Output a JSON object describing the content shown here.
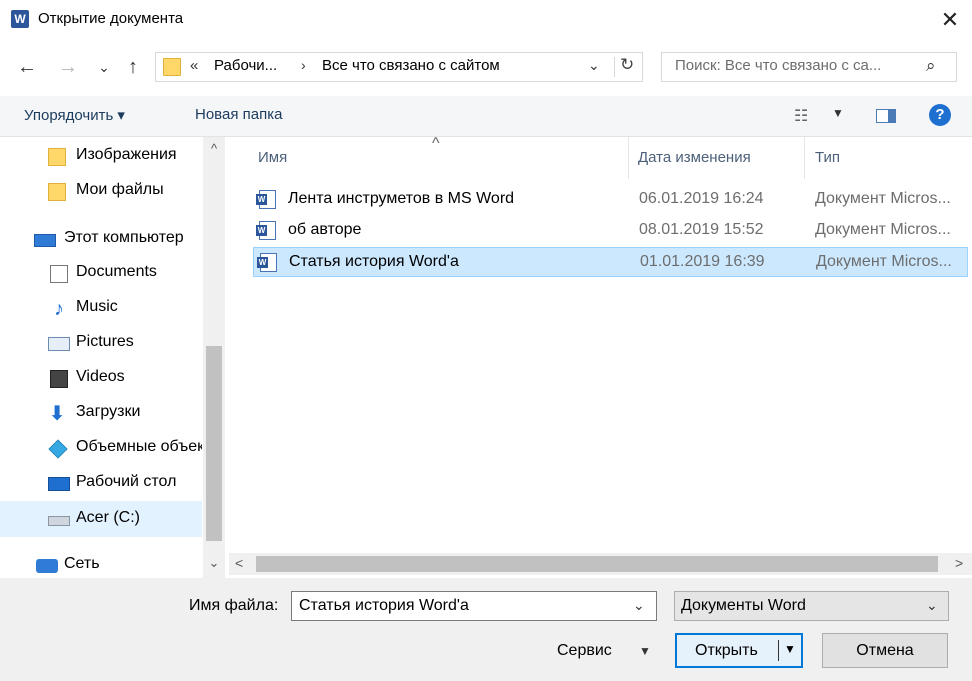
{
  "window": {
    "title": "Открытие документа",
    "app_icon_letter": "W",
    "close_glyph": "✕"
  },
  "nav": {
    "back": "←",
    "forward": "→",
    "recent": "⌄",
    "up": "↑",
    "address": {
      "overflow": "«",
      "segment1": "Рабочи...",
      "separator": "›",
      "segment2": "Все что связано с сайтом",
      "dropdown": "⌄",
      "refresh": "↻"
    },
    "search": {
      "placeholder": "Поиск: Все что связано с са...",
      "icon": "⌕"
    }
  },
  "toolbar": {
    "organize": "Упорядочить ▾",
    "new_folder": "Новая папка",
    "view_icon": "☷",
    "view_dd": "▼",
    "help": "?"
  },
  "sidebar": {
    "items": [
      {
        "label": "Изображения",
        "icon": "folder"
      },
      {
        "label": "Мои файлы",
        "icon": "folder"
      },
      {
        "label": "Этот компьютер",
        "icon": "pc"
      },
      {
        "label": "Documents",
        "icon": "doc"
      },
      {
        "label": "Music",
        "icon": "music",
        "glyph": "♪"
      },
      {
        "label": "Pictures",
        "icon": "pic"
      },
      {
        "label": "Videos",
        "icon": "video"
      },
      {
        "label": "Загрузки",
        "icon": "down",
        "glyph": "⬇"
      },
      {
        "label": "Объемные объекты",
        "icon": "3d"
      },
      {
        "label": "Рабочий стол",
        "icon": "desk"
      },
      {
        "label": "Acer (C:)",
        "icon": "drive"
      },
      {
        "label": "Сеть",
        "icon": "net"
      }
    ],
    "scroll_up": "^",
    "scroll_down": "⌄"
  },
  "filelist": {
    "columns": {
      "name": "Имя",
      "date": "Дата изменения",
      "type": "Тип"
    },
    "sort_caret": "^",
    "rows": [
      {
        "name": "Лента инструметов в MS Word",
        "date": "06.01.2019 16:24",
        "type": "Документ Micros..."
      },
      {
        "name": "об авторе",
        "date": "08.01.2019 15:52",
        "type": "Документ Micros..."
      },
      {
        "name": "Статья история Word'a",
        "date": "01.01.2019 16:39",
        "type": "Документ Micros..."
      }
    ],
    "hscroll_left": "<",
    "hscroll_right": ">"
  },
  "footer": {
    "filename_label": "Имя файла:",
    "filename_value": "Статья история Word'a",
    "filename_dd": "⌄",
    "filetype_value": "Документы Word",
    "filetype_dd": "⌄",
    "service": "Сервис",
    "service_dd": "▼",
    "open": "Открыть",
    "open_dd": "▼",
    "cancel": "Отмена"
  },
  "colors": {
    "accent": "#0078d7",
    "selection": "#cce8ff",
    "link_text": "#1c3b5e"
  }
}
